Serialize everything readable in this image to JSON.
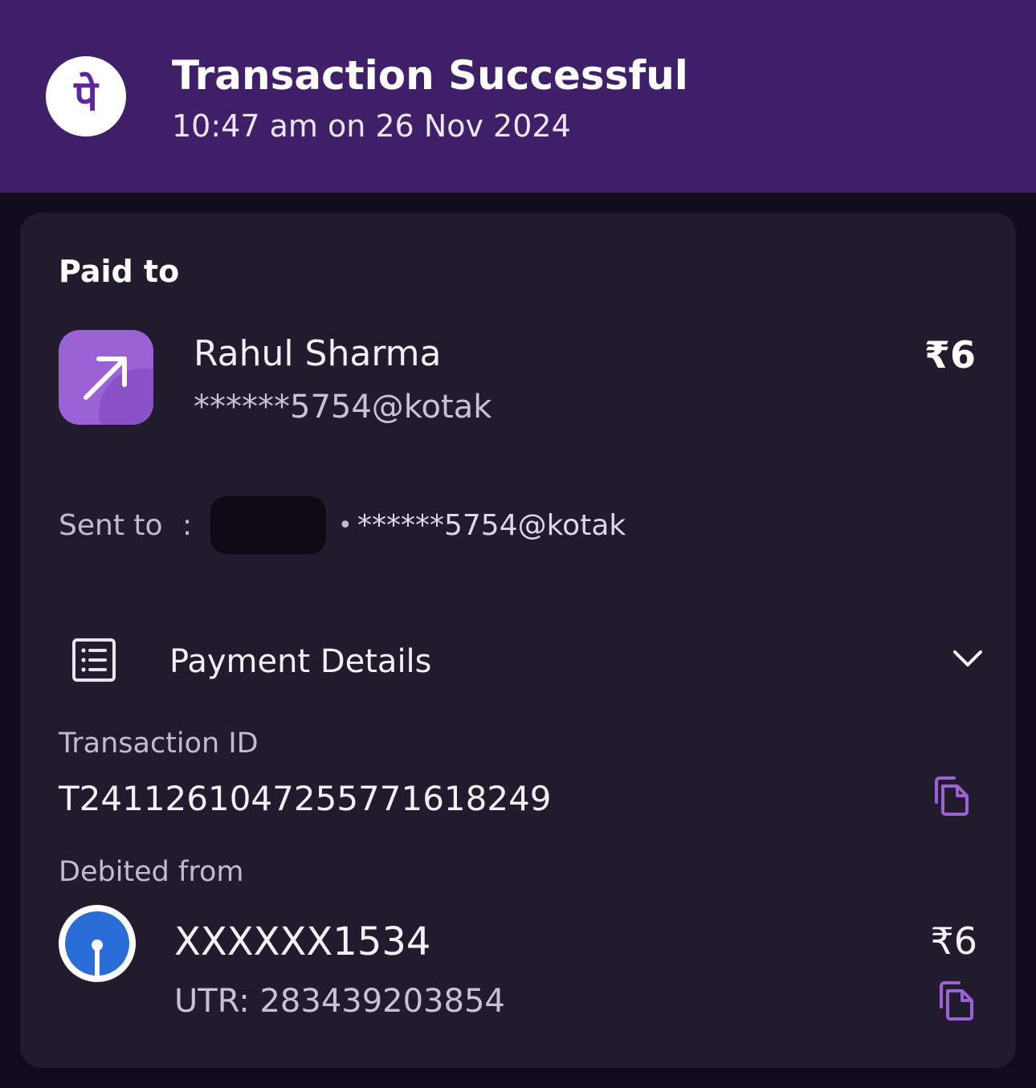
{
  "header": {
    "title": "Transaction Successful",
    "time": "10:47 am on 26 Nov 2024",
    "logo_glyph": "पे",
    "bg_color": "#3f1f68"
  },
  "paid_to": {
    "label": "Paid to",
    "name": "Rahul Sharma",
    "vpa": "******5754@kotak",
    "amount": "₹6",
    "icon": "arrow-up-right-icon"
  },
  "sent_to": {
    "label": "Sent to",
    "colon": ":",
    "separator": "•",
    "vpa": "******5754@kotak"
  },
  "payment_details": {
    "label": "Payment Details",
    "icon": "receipt-icon",
    "toggle_icon": "chevron-down-icon"
  },
  "transaction": {
    "id_label": "Transaction ID",
    "id_value": "T2411261047255771618249"
  },
  "debited_from": {
    "label": "Debited from",
    "account": "XXXXXX1534",
    "amount": "₹6",
    "utr": "UTR: 283439203854",
    "bank_icon": "bank-logo-icon"
  },
  "colors": {
    "accent": "#9b62d6",
    "card_bg": "#221b2e",
    "page_bg": "#120b1c",
    "bank_blue": "#2a6dd6"
  }
}
